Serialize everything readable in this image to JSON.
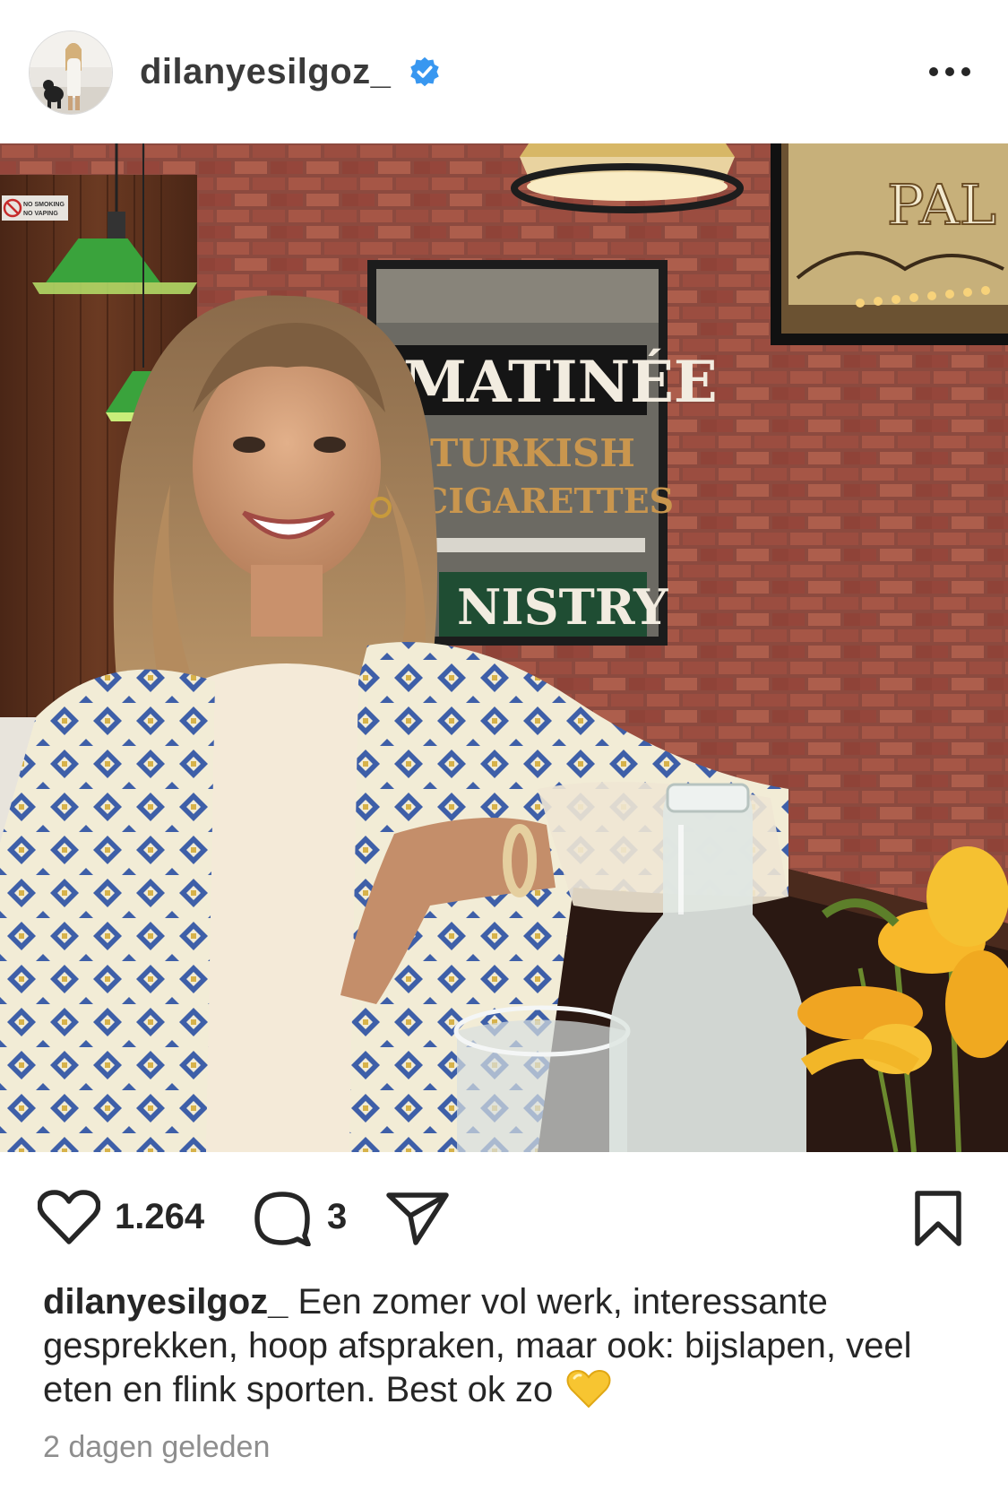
{
  "post": {
    "username": "dilanyesilgoz_",
    "verified": true,
    "more_icon": "more-horizontal-icon",
    "photo": {
      "sign_matinee": "MATINÉE",
      "sign_turkish": "TURKISH",
      "sign_cigarettes": "CIGARETTES",
      "sign_ministry": "NISTRY",
      "poster_text": "PAL",
      "no_smoking_line1": "NO SMOKING",
      "no_smoking_line2": "NO VAPING"
    },
    "actions": {
      "like_icon": "heart-outline-icon",
      "likes_count": "1.264",
      "comment_icon": "comment-bubble-icon",
      "comments_count": "3",
      "share_icon": "send-paper-plane-icon",
      "save_icon": "bookmark-outline-icon"
    },
    "caption": {
      "username": "dilanyesilgoz_",
      "text": "Een zomer vol werk, interessante gesprekken, hoop afspraken, maar ook: bijslapen, veel eten en flink sporten. Best ok zo",
      "emoji": "yellow-heart-emoji"
    },
    "timestamp": "2 dagen geleden"
  },
  "colors": {
    "verified_blue": "#3897f0",
    "text": "#262626",
    "muted": "#8e8e8e",
    "heart_yellow": "#f7c531"
  }
}
